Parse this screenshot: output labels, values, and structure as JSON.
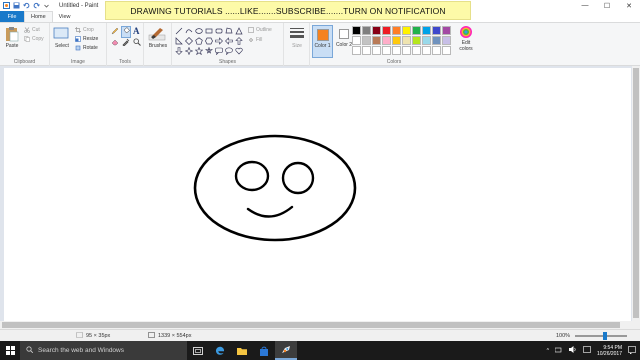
{
  "window": {
    "title": "Untitled - Paint",
    "controls": {
      "minimize": "—",
      "maximize": "☐",
      "close": "✕"
    }
  },
  "banner": {
    "text": "DRAWING TUTORIALS ......LIKE.......SUBSCRIBE.......TURN ON NOTIFICATION"
  },
  "tabs": [
    {
      "label": "File"
    },
    {
      "label": "Home"
    },
    {
      "label": "View"
    }
  ],
  "ribbon": {
    "clipboard": {
      "paste": "Paste",
      "cut": "Cut",
      "copy": "Copy",
      "group": "Clipboard"
    },
    "image": {
      "select": "Select",
      "crop": "Crop",
      "resize": "Resize",
      "rotate": "Rotate",
      "group": "Image"
    },
    "tools": {
      "group": "Tools"
    },
    "brushes": {
      "label": "Brushes"
    },
    "shapes": {
      "outline": "Outline",
      "fill": "Fill",
      "group": "Shapes"
    },
    "size": {
      "label": "Size"
    },
    "colors": {
      "color1": "Color 1",
      "color2": "Color 2",
      "edit": "Edit colors",
      "group": "Colors",
      "color1_value": "#f58220",
      "color2_value": "#ffffff",
      "palette": [
        "#000000",
        "#7f7f7f",
        "#880015",
        "#ed1c24",
        "#ff7f27",
        "#fff200",
        "#22b14c",
        "#00a2e8",
        "#3f48cc",
        "#a349a4",
        "#ffffff",
        "#c3c3c3",
        "#b97a57",
        "#ffaec9",
        "#ffc90e",
        "#efe4b0",
        "#b5e61d",
        "#99d9ea",
        "#7092be",
        "#c8bfe7",
        "#ffffff",
        "#ffffff",
        "#ffffff",
        "#ffffff",
        "#ffffff",
        "#ffffff",
        "#ffffff",
        "#ffffff",
        "#ffffff",
        "#ffffff"
      ]
    }
  },
  "status": {
    "selection": "95 × 35px",
    "canvas_size": "1339 × 554px",
    "zoom": "100%"
  },
  "taskbar": {
    "search_placeholder": "Search the web and Windows",
    "time": "9:54 PM",
    "date": "10/26/2017"
  }
}
